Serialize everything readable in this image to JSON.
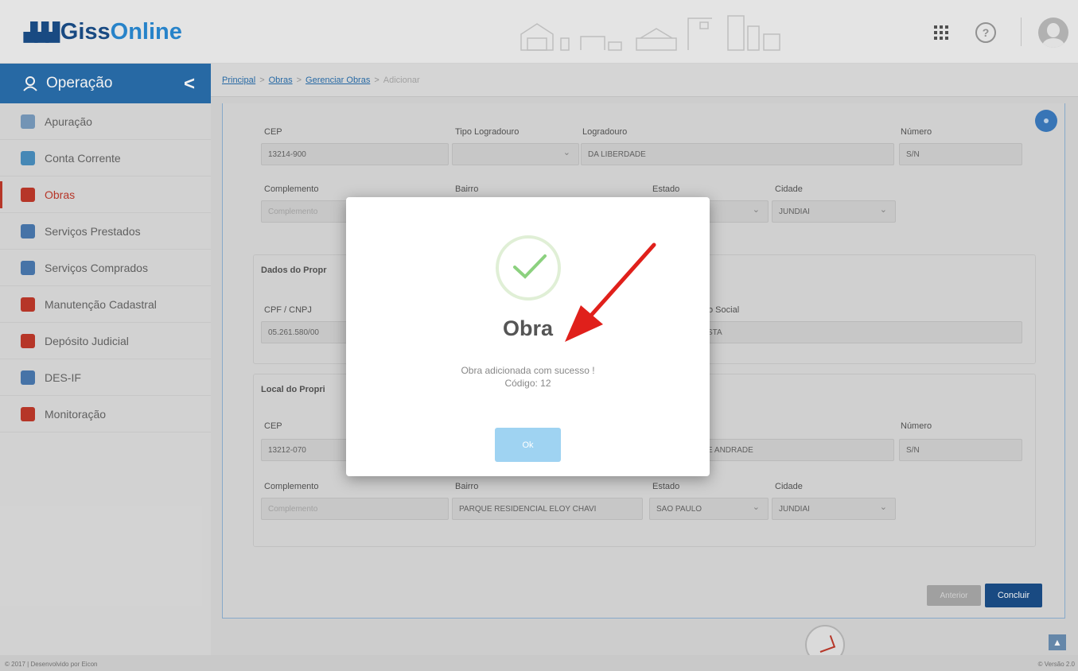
{
  "header": {
    "logo_brand": "Giss",
    "logo_suffix": "Online",
    "apps_icon": "apps-grid-icon",
    "help_icon": "help-icon",
    "help_glyph": "?",
    "avatar_icon": "user-avatar-icon"
  },
  "sidebar": {
    "title": "Operação",
    "items": [
      {
        "label": "Apuração",
        "icon": "calculator-icon",
        "color": "#7a9cbf"
      },
      {
        "label": "Conta Corrente",
        "icon": "wallet-icon",
        "color": "#4a90c0"
      },
      {
        "label": "Obras",
        "icon": "crane-icon",
        "color": "#c0392b",
        "active": true
      },
      {
        "label": "Serviços Prestados",
        "icon": "document-out-icon",
        "color": "#4a7ab0"
      },
      {
        "label": "Serviços Comprados",
        "icon": "document-in-icon",
        "color": "#4a7ab0"
      },
      {
        "label": "Manutenção Cadastral",
        "icon": "tools-icon",
        "color": "#c0392b"
      },
      {
        "label": "Depósito Judicial",
        "icon": "gavel-icon",
        "color": "#c0392b"
      },
      {
        "label": "DES-IF",
        "icon": "bank-icon",
        "color": "#4a7ab0"
      },
      {
        "label": "Monitoração",
        "icon": "monitor-icon",
        "color": "#c0392b"
      }
    ]
  },
  "breadcrumb": {
    "items": [
      "Principal",
      "Obras",
      "Gerenciar Obras"
    ],
    "current": "Adicionar",
    "separator": ">"
  },
  "form": {
    "obra_address": {
      "cep_label": "CEP",
      "cep_value": "13214-900",
      "tipo_logradouro_label": "Tipo Logradouro",
      "tipo_logradouro_value": "",
      "logradouro_label": "Logradouro",
      "logradouro_value": "DA LIBERDADE",
      "numero_label": "Número",
      "numero_value": "S/N",
      "complemento_label": "Complemento",
      "complemento_placeholder": "Complemento",
      "bairro_label": "Bairro",
      "estado_label": "Estado",
      "cidade_label": "Cidade",
      "cidade_value": "JUNDIAI"
    },
    "owner": {
      "title": "Dados do Propr",
      "cpf_label": "CPF / CNPJ",
      "cpf_value": "05.261.580/00",
      "razao_label": "o Social",
      "razao_value": "STA"
    },
    "owner_address": {
      "title": "Local do Propri",
      "cep_label": "CEP",
      "cep_value": "13212-070",
      "logradouro_value": "E ANDRADE",
      "numero_label": "Número",
      "numero_value": "S/N",
      "complemento_label": "Complemento",
      "complemento_placeholder": "Complemento",
      "bairro_label": "Bairro",
      "bairro_value": "PARQUE RESIDENCIAL ELOY CHAVI",
      "estado_label": "Estado",
      "estado_value": "SAO PAULO",
      "cidade_label": "Cidade",
      "cidade_value": "JUNDIAI"
    },
    "buttons": {
      "previous": "Anterior",
      "finish": "Concluir"
    }
  },
  "modal": {
    "icon": "success-check-icon",
    "accent": "#8cd17f",
    "title": "Obra",
    "message": "Obra adicionada com sucesso !",
    "code": "Código: 12",
    "ok_label": "Ok"
  },
  "footer": {
    "copyright": "© 2017 | Desenvolvido por Eicon",
    "version": "© Versão 2.0",
    "scroll_top_icon": "chevron-up-icon",
    "scroll_glyph": "▲"
  }
}
